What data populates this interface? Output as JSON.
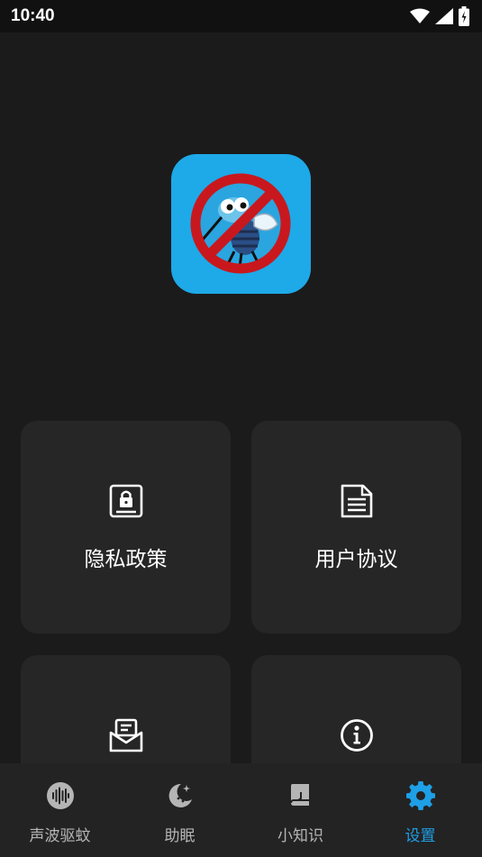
{
  "status_bar": {
    "time": "10:40"
  },
  "colors": {
    "accent": "#1e9fe6",
    "background": "#1b1b1b",
    "card": "#262626",
    "tab_inactive": "#b5b5b5"
  },
  "app": {
    "logo_icon": "no-mosquito-icon"
  },
  "cards": [
    {
      "id": "privacy",
      "label": "隐私政策",
      "icon": "lock-document-icon"
    },
    {
      "id": "terms",
      "label": "用户协议",
      "icon": "document-icon"
    },
    {
      "id": "feedback",
      "label": "",
      "icon": "mail-open-icon"
    },
    {
      "id": "about",
      "label": "",
      "icon": "info-icon"
    }
  ],
  "tabs": [
    {
      "label": "声波驱蚊",
      "icon": "sound-wave-icon",
      "active": false
    },
    {
      "label": "助眠",
      "icon": "moon-icon",
      "active": false
    },
    {
      "label": "小知识",
      "icon": "book-icon",
      "active": false
    },
    {
      "label": "设置",
      "icon": "gear-icon",
      "active": true
    }
  ]
}
